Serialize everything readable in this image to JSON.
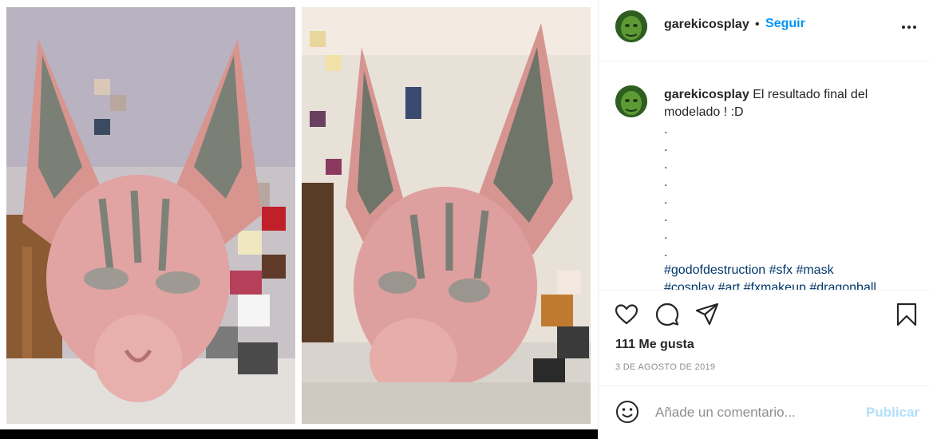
{
  "post": {
    "username": "garekicosplay",
    "separator": "•",
    "follow_label": "Seguir",
    "more_icon": "more-horizontal-icon"
  },
  "caption": {
    "username": "garekicosplay",
    "text": "El resultado final del modelado ! :D",
    "dots": [
      ".",
      ".",
      ".",
      ".",
      ".",
      ".",
      ".",
      "."
    ],
    "hashtags_line1": "#godofdestruction #sfx #mask",
    "hashtags_line2": "#cosplay #art #fxmakeup #dragonball"
  },
  "actions": {
    "icons": [
      "heart-icon",
      "comment-icon",
      "share-icon",
      "bookmark-icon"
    ],
    "likes": "111 Me gusta",
    "date": "3 DE AGOSTO DE 2019"
  },
  "comment": {
    "placeholder": "Añade un comentario...",
    "publish_label": "Publicar",
    "emoji_icon": "emoji-icon"
  },
  "colors": {
    "link_blue": "#0095f6",
    "publish_disabled": "#b2dffc",
    "hashtag": "#00376b",
    "muted": "#8e8e8e"
  }
}
